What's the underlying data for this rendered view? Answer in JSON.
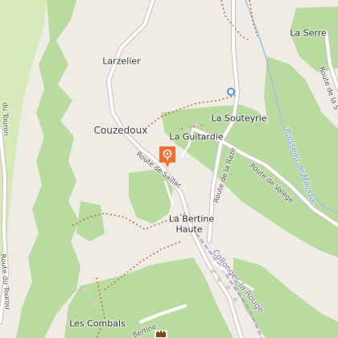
{
  "colors": {
    "background": "#efebe5",
    "forest": "#b9dba0",
    "meadow": "#d6eab9",
    "forest_dark": "#a8d090",
    "road": "#ffffff",
    "road_casing": "#c9c2b8",
    "path": "#c0783e",
    "river": "#9fc2e8",
    "marker": "#f07034",
    "commune_boundary": "#b49ad0"
  },
  "places": {
    "larzelier": "Larzelier",
    "la_serre": "La Serre",
    "couzedoux": "Couzedoux",
    "la_souteyrie": "La Souteyrie",
    "la_guitardie": "La Guitardie",
    "la_bertine_haute_1": "La Bertine",
    "la_bertine_haute_2": "Haute",
    "les_combals": "Les Combals"
  },
  "roads": {
    "route_de_sailllac": "Route de Saillac",
    "route_de_la_raze": "Route de la Raze",
    "route_de_valege": "Route de Valège",
    "route_du_tourou_left": "Route du Tourou",
    "route_du_tourou_top": "du Touron",
    "route_de_la_serre": "Route de la S",
    "bertine_bottom": "Bertine"
  },
  "water": {
    "ruisseau": "Ruisseau de Maussac"
  },
  "commune": {
    "name": "Collonges-la-Rouge"
  },
  "markers": {
    "selected_icon": "location-pin-icon",
    "waypoint_icon": "waypoint-circle-icon",
    "castle_icon": "castle-icon"
  }
}
